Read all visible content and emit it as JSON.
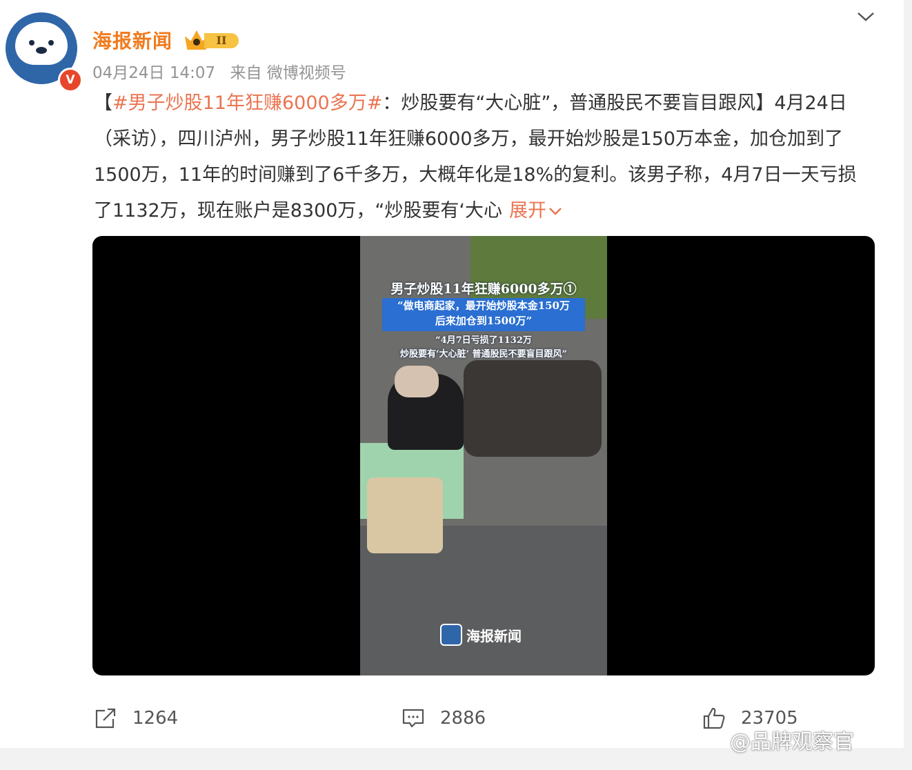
{
  "post": {
    "author": "海报新闻",
    "level_badge": "II",
    "verified_mark": "V",
    "date": "04月24日 14:07",
    "source": "来自 微博视频号",
    "content": {
      "open_bracket": "【",
      "hashtag": "#男子炒股11年狂赚6000多万#",
      "title_rest": "：炒股要有“大心脏”，普通股民不要盲目跟风】",
      "body": "4月24日（采访），四川泸州，男子炒股11年狂赚6000多万，最开始炒股是150万本金，加仓加到了1500万，11年的时间赚到了6千多万，大概年化是18%的复利。该男子称，4月7日一天亏损了1132万，现在账户是8300万，“炒股要有‘大心",
      "expand_label": "展开"
    },
    "video": {
      "caption_title": "男子炒股11年狂赚6000多万①",
      "caption_box_line1": "“做电商起家，最开始炒股本金150万",
      "caption_box_line2": "后来加仓到1500万”",
      "caption_line3": "“4月7日亏损了1132万",
      "caption_line4": "炒股要有‘大心脏’  普通股民不要盲目跟风”",
      "watermark_text": "海报新闻"
    },
    "actions": {
      "share_count": "1264",
      "comment_count": "2886",
      "like_count": "23705"
    }
  },
  "site_watermark": "@品牌观察官",
  "colors": {
    "accent": "#eb7350",
    "name": "#f07b1e",
    "avatar_blue": "#2f66a8",
    "verified_red": "#e8462b"
  },
  "icons": {
    "collapse": "chevron-down-icon",
    "share": "share-icon",
    "comment": "comment-icon",
    "like": "thumbs-up-icon"
  }
}
